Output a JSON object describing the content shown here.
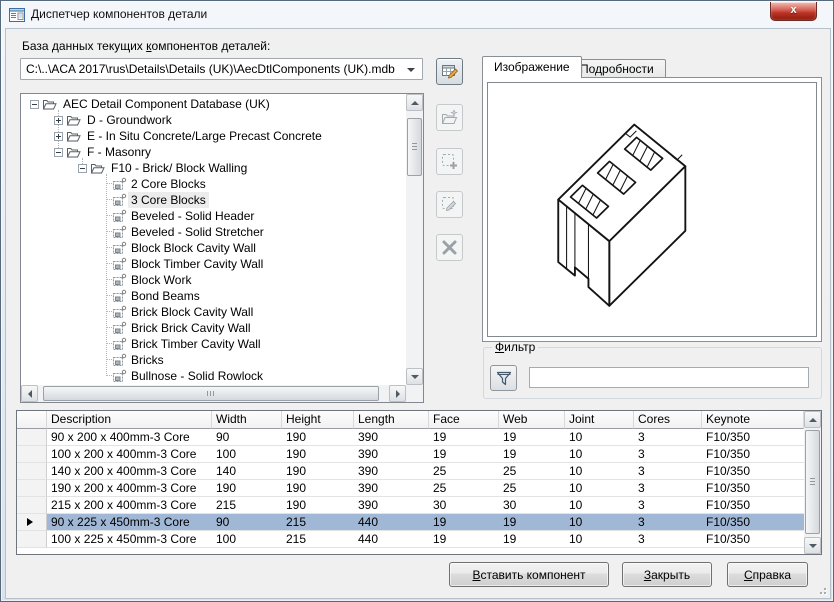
{
  "window": {
    "title": "Диспетчер компонентов детали",
    "close_glyph": "x"
  },
  "database": {
    "label_pre": "База данных текущих ",
    "label_accel": "к",
    "label_post": "омпонентов деталей:",
    "path": "C:\\..\\ACA 2017\\rus\\Details\\Details (UK)\\AecDtlComponents (UK).mdb"
  },
  "toolbar_icons": [
    "edit-database-icon",
    "new-folder-icon",
    "add-component-icon",
    "edit-component-icon",
    "delete-component-icon"
  ],
  "tree": {
    "items": [
      {
        "label": "AEC Detail Component Database (UK)",
        "level": 0,
        "expand": "minus",
        "icon": "folder-open",
        "selected": false
      },
      {
        "label": "D - Groundwork",
        "level": 1,
        "expand": "plus",
        "icon": "folder-open",
        "selected": false
      },
      {
        "label": "E - In Situ Concrete/Large Precast Concrete",
        "level": 1,
        "expand": "plus",
        "icon": "folder-open",
        "selected": false
      },
      {
        "label": "F - Masonry",
        "level": 1,
        "expand": "minus",
        "icon": "folder-open",
        "selected": false
      },
      {
        "label": "F10 - Brick/ Block Walling",
        "level": 2,
        "expand": "minus",
        "icon": "folder-open",
        "selected": false
      },
      {
        "label": "2 Core Blocks",
        "level": 3,
        "expand": null,
        "icon": "component",
        "selected": false
      },
      {
        "label": "3 Core Blocks",
        "level": 3,
        "expand": null,
        "icon": "component",
        "selected": true
      },
      {
        "label": "Beveled - Solid Header",
        "level": 3,
        "expand": null,
        "icon": "component",
        "selected": false
      },
      {
        "label": "Beveled - Solid Stretcher",
        "level": 3,
        "expand": null,
        "icon": "component",
        "selected": false
      },
      {
        "label": "Block Block Cavity Wall",
        "level": 3,
        "expand": null,
        "icon": "component",
        "selected": false
      },
      {
        "label": "Block Timber Cavity Wall",
        "level": 3,
        "expand": null,
        "icon": "component",
        "selected": false
      },
      {
        "label": "Block Work",
        "level": 3,
        "expand": null,
        "icon": "component",
        "selected": false
      },
      {
        "label": "Bond Beams",
        "level": 3,
        "expand": null,
        "icon": "component",
        "selected": false
      },
      {
        "label": "Brick Block Cavity Wall",
        "level": 3,
        "expand": null,
        "icon": "component",
        "selected": false
      },
      {
        "label": "Brick Brick Cavity Wall",
        "level": 3,
        "expand": null,
        "icon": "component",
        "selected": false
      },
      {
        "label": "Brick Timber Cavity Wall",
        "level": 3,
        "expand": null,
        "icon": "component",
        "selected": false
      },
      {
        "label": "Bricks",
        "level": 3,
        "expand": null,
        "icon": "component",
        "selected": false
      },
      {
        "label": "Bullnose - Solid Rowlock",
        "level": 3,
        "expand": null,
        "icon": "component",
        "selected": false
      }
    ]
  },
  "tabs": [
    {
      "label": "Изображение",
      "active": true
    },
    {
      "label": "Подробности",
      "active": false
    }
  ],
  "preview": {
    "image_name": "3-core-concrete-block-isometric-drawing"
  },
  "filter": {
    "legend_accel": "Ф",
    "legend_post": "ильтр",
    "icon": "funnel-icon",
    "input_value": ""
  },
  "table": {
    "columns": [
      "Description",
      "Width",
      "Height",
      "Length",
      "Face",
      "Web",
      "Joint",
      "Cores",
      "Keynote"
    ],
    "rows": [
      [
        "90 x 200 x 400mm-3 Core",
        "90",
        "190",
        "390",
        "19",
        "19",
        "10",
        "3",
        "F10/350"
      ],
      [
        "100 x 200 x 400mm-3 Core",
        "100",
        "190",
        "390",
        "19",
        "19",
        "10",
        "3",
        "F10/350"
      ],
      [
        "140 x 200 x 400mm-3 Core",
        "140",
        "190",
        "390",
        "25",
        "25",
        "10",
        "3",
        "F10/350"
      ],
      [
        "190 x 200 x 400mm-3 Core",
        "190",
        "190",
        "390",
        "25",
        "25",
        "10",
        "3",
        "F10/350"
      ],
      [
        "215 x 200 x 400mm-3 Core",
        "215",
        "190",
        "390",
        "30",
        "30",
        "10",
        "3",
        "F10/350"
      ],
      [
        "90 x 225 x 450mm-3 Core",
        "90",
        "215",
        "440",
        "19",
        "19",
        "10",
        "3",
        "F10/350"
      ],
      [
        "100 x 225 x 450mm-3 Core",
        "100",
        "215",
        "440",
        "19",
        "19",
        "10",
        "3",
        "F10/350"
      ]
    ],
    "selected_row": 5
  },
  "buttons": {
    "insert": {
      "accel": "В",
      "post": "ставить компонент"
    },
    "close": {
      "accel": "З",
      "post": "акрыть"
    },
    "help": {
      "accel": "С",
      "post": "правка"
    }
  },
  "colors": {
    "grid_selection": "#a0b7d5",
    "tree_selection": "#ececec",
    "close_button": "#bc3527",
    "dialog_bg": "#f0f0f0"
  }
}
